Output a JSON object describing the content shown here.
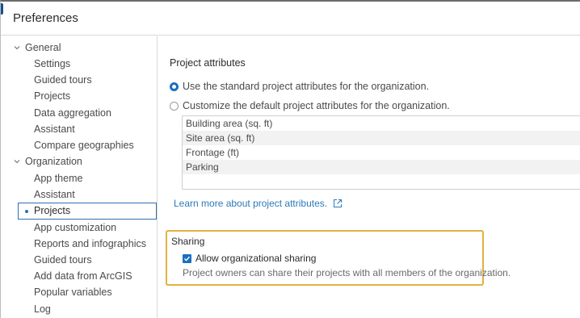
{
  "dialog": {
    "title": "Preferences"
  },
  "sidebar": {
    "groups": [
      {
        "label": "General",
        "items": [
          {
            "label": "Settings"
          },
          {
            "label": "Guided tours"
          },
          {
            "label": "Projects"
          },
          {
            "label": "Data aggregation"
          },
          {
            "label": "Assistant"
          },
          {
            "label": "Compare geographies"
          }
        ]
      },
      {
        "label": "Organization",
        "items": [
          {
            "label": "App theme"
          },
          {
            "label": "Assistant"
          },
          {
            "label": "Projects"
          },
          {
            "label": "App customization"
          },
          {
            "label": "Reports and infographics"
          },
          {
            "label": "Guided tours"
          },
          {
            "label": "Add data from ArcGIS"
          },
          {
            "label": "Popular variables"
          },
          {
            "label": "Log"
          }
        ]
      }
    ],
    "selected": "Organization / Projects"
  },
  "project_attributes": {
    "title": "Project attributes",
    "options": [
      {
        "label": "Use the standard project attributes for the organization.",
        "checked": true
      },
      {
        "label": "Customize the default project attributes for the organization.",
        "checked": false
      }
    ],
    "attributes": [
      "Building area (sq. ft)",
      "Site area (sq. ft)",
      "Frontage (ft)",
      "Parking"
    ],
    "learn_more": "Learn more about project attributes."
  },
  "sharing": {
    "title": "Sharing",
    "checkbox_label": "Allow organizational sharing",
    "checked": true,
    "description": "Project owners can share their projects with all members of the organization."
  },
  "colors": {
    "accent": "#1a6fc2",
    "link": "#2c7ab8",
    "highlight_border": "#e2b33d",
    "selection_border": "#2f6fae"
  },
  "icons": {
    "group_toggle": "chevron-down-icon",
    "external_link": "external-link-icon",
    "checkbox_mark": "check-icon"
  }
}
